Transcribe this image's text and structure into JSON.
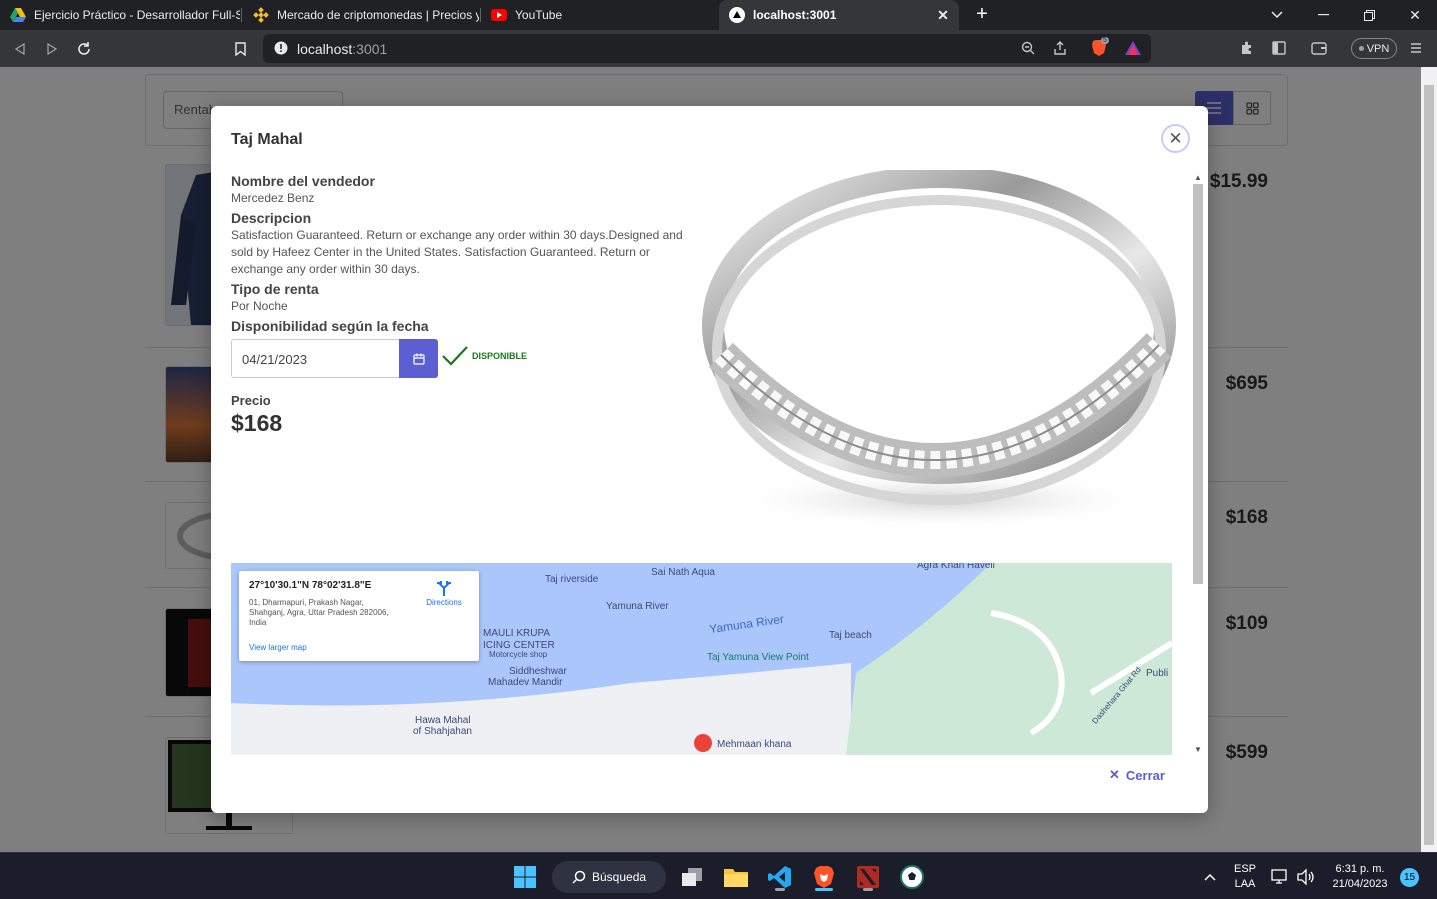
{
  "browser": {
    "tabs": [
      {
        "title": "Ejercicio Práctico - Desarrollador Full-S",
        "icon": "google-drive-icon"
      },
      {
        "title": "Mercado de criptomonedas | Precios y",
        "icon": "binance-icon"
      },
      {
        "title": "YouTube",
        "icon": "youtube-icon"
      },
      {
        "title": "localhost:3001",
        "icon": "vercel-icon"
      }
    ],
    "url_host": "localhost",
    "url_port": ":3001",
    "vpn_label": "VPN",
    "brave_badge": "5"
  },
  "page": {
    "filter_placeholder": "Rentab",
    "list": [
      {
        "price": "$15.99"
      },
      {
        "price": "$695"
      },
      {
        "price": "$168"
      },
      {
        "price": "$109"
      },
      {
        "price": "$599"
      }
    ]
  },
  "modal": {
    "title": "Taj Mahal",
    "seller_label": "Nombre del vendedor",
    "seller_value": "Mercedez Benz",
    "description_label": "Descripcion",
    "description_value": "Satisfaction Guaranteed. Return or exchange any order within 30 days.Designed and sold by Hafeez Center in the United States. Satisfaction Guaranteed. Return or exchange any order within 30 days.",
    "rent_type_label": "Tipo de renta",
    "rent_type_value": "Por Noche",
    "availability_label": "Disponibilidad según la fecha",
    "date_value": "04/21/2023",
    "availability_status": "DISPONIBLE",
    "price_label": "Precio",
    "price_value": "$168",
    "close_label": "Cerrar",
    "map": {
      "coordinates": "27°10'30.1\"N 78°02'31.8\"E",
      "address": "01, Dharmapuri, Prakash Nagar, Shahganj, Agra, Uttar Pradesh 282006, India",
      "directions": "Directions",
      "larger_map": "View larger map",
      "places": [
        "Taj riverside",
        "Sai Nath Aqua",
        "Agra Khan Haveli",
        "Yamuna River",
        "Yamuna River",
        "Taj beach",
        "MAULI KRUPA",
        "ICING CENTER",
        "Motorcycle shop",
        "Siddheshwar",
        "Mahadev Mandir",
        "Taj Yamuna View Point",
        "Hawa Mahal",
        "of Shahjahan",
        "Mehmaan khana",
        "Publi",
        "Dashehara Ghat Rd"
      ]
    }
  },
  "taskbar": {
    "search_label": "Búsqueda",
    "lang_line1": "ESP",
    "lang_line2": "LAA",
    "time": "6:31 p. m.",
    "date": "21/04/2023",
    "notifications": "15"
  }
}
